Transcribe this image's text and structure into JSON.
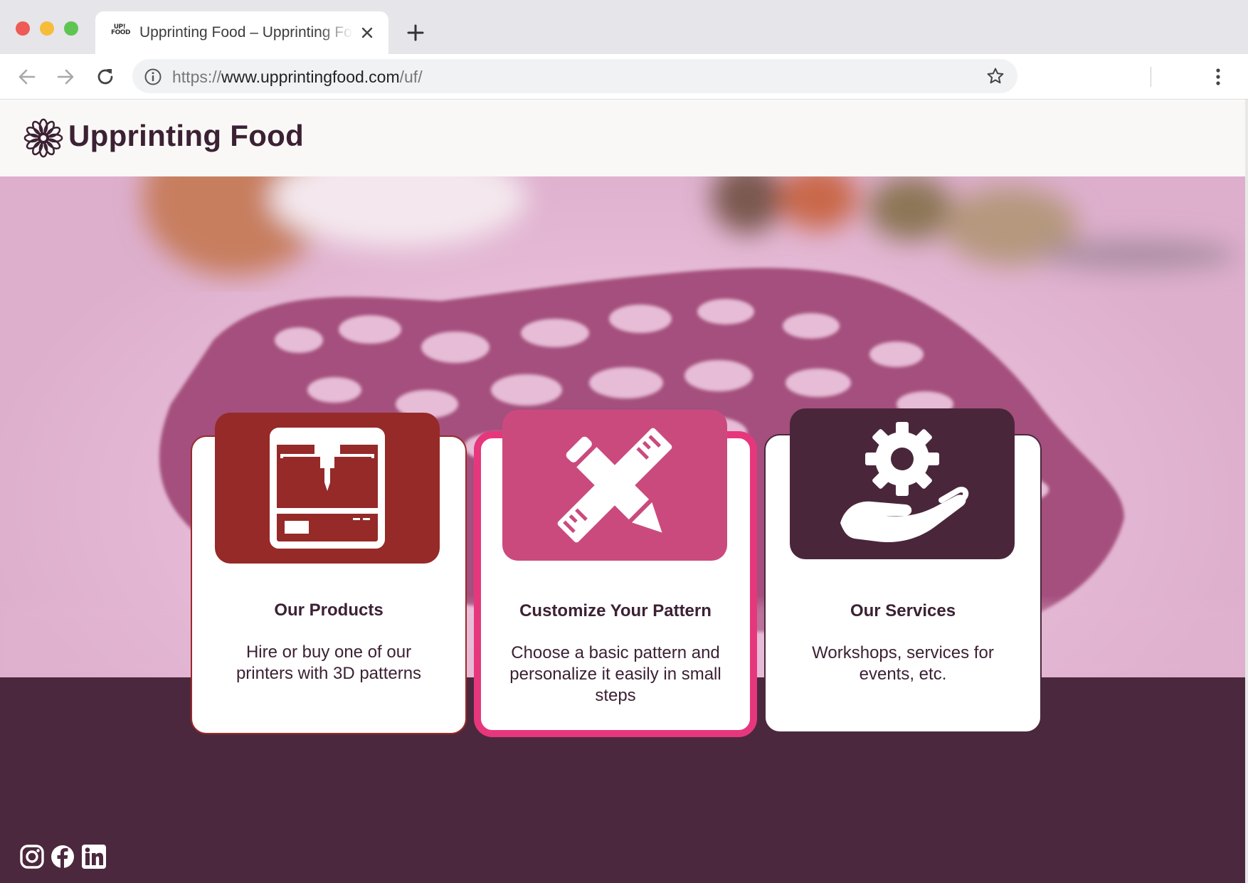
{
  "browser": {
    "tab": {
      "favicon_text": "UP! FOOD",
      "title": "Upprinting Food – Upprinting Food"
    },
    "url": {
      "scheme": "https://",
      "host": "www.upprintingfood.com",
      "path": "/uf/"
    },
    "icons": [
      "close-icon",
      "plus-icon",
      "back-arrow-icon",
      "forward-arrow-icon",
      "reload-icon",
      "info-icon",
      "star-icon",
      "more-vertical-icon"
    ]
  },
  "site": {
    "logo_text": "Upprinting Food",
    "logo_icon": "flower-icon",
    "colors": {
      "brand_dark": "#4b283d",
      "products": "#952a28",
      "customize": "#cb4a7e",
      "customize_border": "#e6377d",
      "services": "#4a263b",
      "hero_pink": "#e8bdd8"
    }
  },
  "cards": [
    {
      "title": "Our Products",
      "description": "Hire or buy one of our printers with 3D patterns",
      "icon": "3d-printer-icon"
    },
    {
      "title": "Customize Your Pattern",
      "description": "Choose a basic pattern and personalize it easily in small steps",
      "icon": "pencil-ruler-icon"
    },
    {
      "title": "Our Services",
      "description": "Workshops, services for events, etc.",
      "icon": "hand-gear-icon"
    }
  ],
  "social": [
    "instagram-icon",
    "facebook-icon",
    "linkedin-icon"
  ]
}
